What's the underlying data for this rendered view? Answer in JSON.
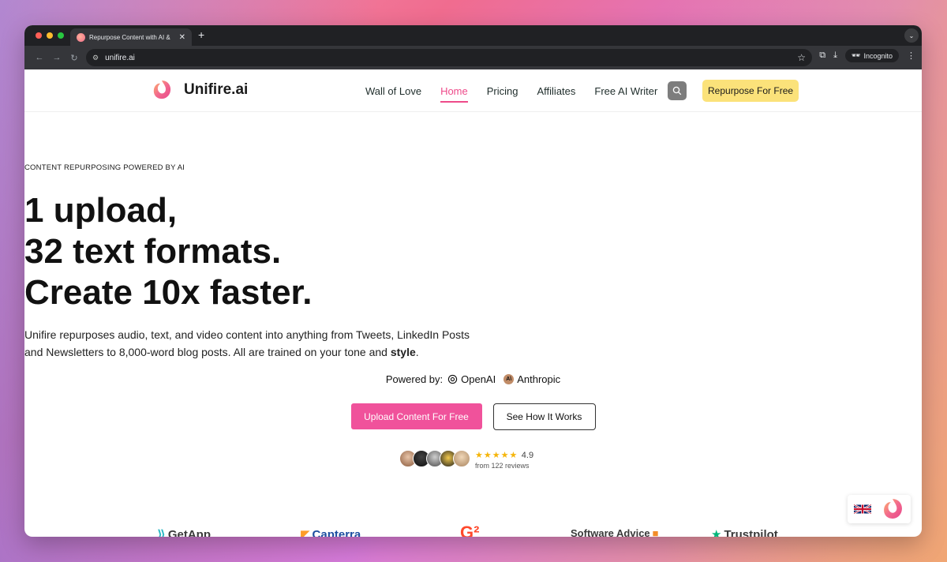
{
  "browser": {
    "tab_title": "Repurpose Content with AI & ",
    "url": "unifire.ai",
    "incognito_label": "Incognito"
  },
  "site": {
    "brand_name": "Unifire.ai",
    "nav": {
      "wall_of_love": "Wall of Love",
      "home": "Home",
      "pricing": "Pricing",
      "affiliates": "Affiliates",
      "free_ai_writer": "Free AI Writer"
    },
    "cta_top": "Repurpose For Free"
  },
  "hero": {
    "eyebrow": "CONTENT REPURPOSING POWERED BY AI",
    "headline_line1": "1 upload,",
    "headline_line2": "32 text formats.",
    "headline_line3": "Create 10x faster.",
    "sub_part1": "Unifire repurposes audio, text, and video content into anything from Tweets, LinkedIn Posts",
    "sub_part2": "and Newsletters to 8,000-word blog posts. All are trained on your tone and",
    "sub_bold": "style",
    "sub_end": ".",
    "powered_label": "Powered by:",
    "provider1": "OpenAI",
    "provider2": "Anthropic",
    "primary_button": "Upload Content For Free",
    "secondary_button": "See How It Works",
    "rating": "4.9",
    "review_count": "from 122 reviews"
  },
  "logos": {
    "getapp": "GetApp",
    "capterra": "Capterra",
    "softwareadvice": "Software Advice",
    "trustpilot": "Trustpilot"
  },
  "colors": {
    "accent_pink": "#f0529b",
    "cta_yellow": "#fbe27a",
    "star": "#f5b50a"
  }
}
